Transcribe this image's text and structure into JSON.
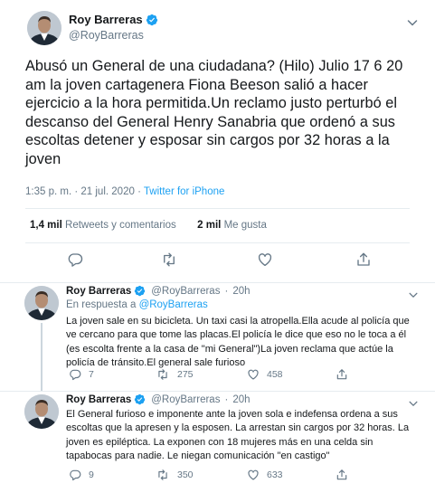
{
  "main_tweet": {
    "display_name": "Roy Barreras",
    "handle": "@RoyBarreras",
    "text": "Abusó un General de una ciudadana? (Hilo) Julio 17 6 20 am la joven cartagenera Fiona Beeson salió a hacer ejercicio a la hora permitida.Un reclamo justo perturbó el descanso del General Henry Sanabria que ordenó a sus escoltas detener y esposar sin cargos por 32 horas a la joven",
    "time": "1:35 p. m.",
    "date": "21 jul. 2020",
    "separator": "·",
    "source": "Twitter for iPhone",
    "retweets_count": "1,4 mil",
    "retweets_label": "Retweets y comentarios",
    "likes_count": "2 mil",
    "likes_label": "Me gusta"
  },
  "replies": [
    {
      "display_name": "Roy Barreras",
      "handle": "@RoyBarreras",
      "dot": "·",
      "time": "20h",
      "in_reply_prefix": "En respuesta a",
      "in_reply_to": "@RoyBarreras",
      "text": "La joven sale en su bicicleta. Un taxi casi la atropella.Ella acude al policía que ve cercano para que tome las placas.El policía le dice que eso no le toca a él (es escolta frente a la casa de \"mi General\")La joven reclama que actúe la policía de tránsito.El general sale furioso",
      "replies": "7",
      "retweets": "275",
      "likes": "458"
    },
    {
      "display_name": "Roy Barreras",
      "handle": "@RoyBarreras",
      "dot": "·",
      "time": "20h",
      "text": "El General furioso e imponente ante la joven sola e indefensa ordena a sus escoltas que la apresen y la esposen. La arrestan sin cargos por 32 horas. La joven es epiléptica. La exponen con 18 mujeres más en una celda sin tapabocas para nadie. Le niegan comunicación \"en castigo\"",
      "replies": "9",
      "retweets": "350",
      "likes": "633"
    }
  ],
  "icons": {
    "verified": "verified-badge-icon",
    "reply": "reply-icon",
    "retweet": "retweet-icon",
    "like": "heart-icon",
    "share": "share-icon",
    "more": "chevron-down-icon"
  },
  "colors": {
    "accent": "#1da1f2",
    "text": "#14171a",
    "muted": "#657786",
    "divider": "#e6ecf0"
  }
}
